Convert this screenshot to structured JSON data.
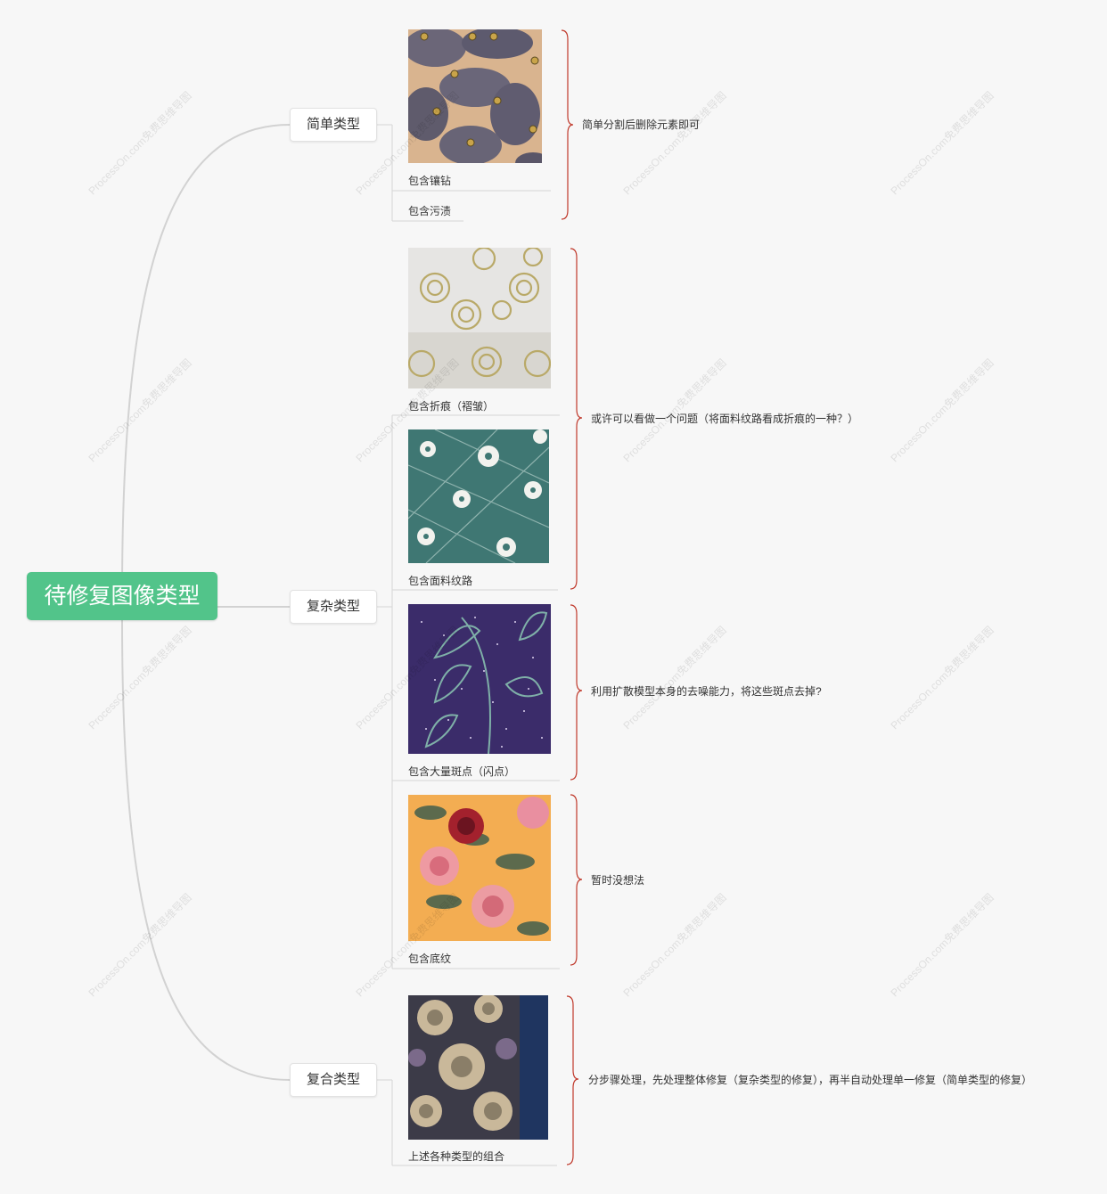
{
  "root": {
    "title": "待修复图像类型"
  },
  "branches": [
    {
      "label": "简单类型"
    },
    {
      "label": "复杂类型"
    },
    {
      "label": "复合类型"
    }
  ],
  "leaves": [
    {
      "label": "包含镶钻"
    },
    {
      "label": "包含污渍"
    },
    {
      "label": "包含折痕（褶皱）"
    },
    {
      "label": "包含面料纹路"
    },
    {
      "label": "包含大量斑点（闪点）"
    },
    {
      "label": "包含底纹"
    },
    {
      "label": "上述各种类型的组合"
    }
  ],
  "notes": [
    {
      "text": "简单分割后删除元素即可"
    },
    {
      "text": "或许可以看做一个问题（将面料纹路看成折痕的一种？）"
    },
    {
      "text": "利用扩散模型本身的去噪能力，将这些斑点去掉?"
    },
    {
      "text": "暂时没想法"
    },
    {
      "text": "分步骤处理，先处理整体修复（复杂类型的修复），再半自动处理单一修复（简单类型的修复）"
    }
  ],
  "watermark": "ProcessOn.com免费思维导图",
  "colors": {
    "root": "#52c48a",
    "brace": "#c0392b",
    "line": "#cfcfcf"
  }
}
